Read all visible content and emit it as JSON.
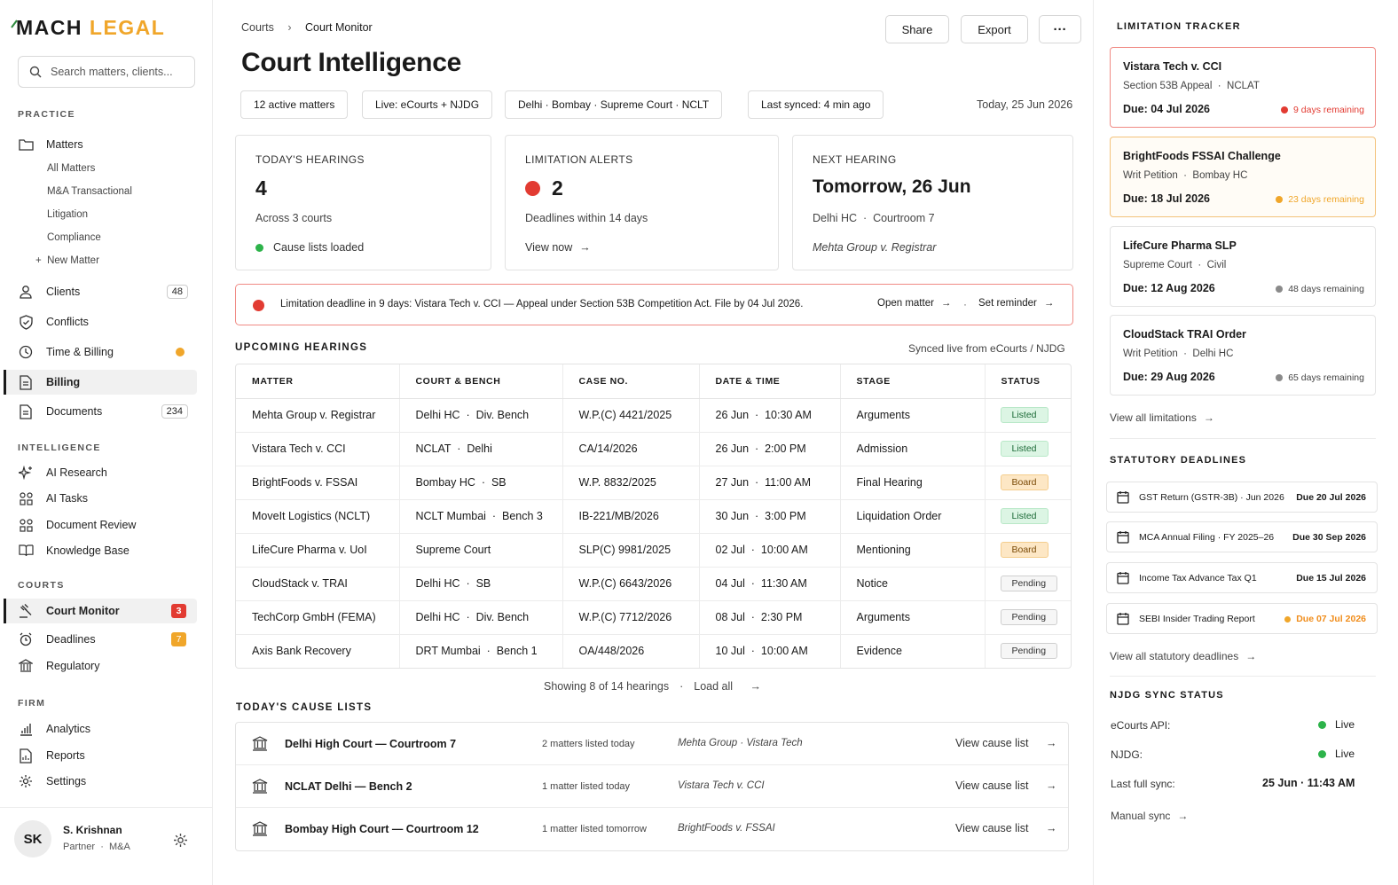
{
  "brand": {
    "part1": "MACH",
    "part2": "LEGAL"
  },
  "search": {
    "placeholder": "Search matters, clients..."
  },
  "sidebar": {
    "practice_heading": "PRACTICE",
    "matters": "Matters",
    "matters_sub": [
      "All Matters",
      "M&A Transactional",
      "Litigation",
      "Compliance",
      "New Matter"
    ],
    "clients": "Clients",
    "clients_count": "48",
    "conflicts": "Conflicts",
    "time_billing": "Time & Billing",
    "billing": "Billing",
    "documents": "Documents",
    "documents_count": "234",
    "intelligence_heading": "INTELLIGENCE",
    "ai_research": "AI Research",
    "ai_tasks": "AI Tasks",
    "document_review": "Document Review",
    "knowledge_base": "Knowledge Base",
    "courts_heading": "COURTS",
    "court_monitor": "Court Monitor",
    "court_monitor_count": "3",
    "deadlines": "Deadlines",
    "deadlines_count": "7",
    "regulatory": "Regulatory",
    "firm_heading": "FIRM",
    "analytics": "Analytics",
    "reports": "Reports",
    "settings": "Settings"
  },
  "user": {
    "initials": "SK",
    "name": "S. Krishnan",
    "role": "Partner",
    "team": "M&A"
  },
  "breadcrumb": {
    "parent": "Courts",
    "current": "Court Monitor"
  },
  "header": {
    "title": "Court Intelligence",
    "share": "Share",
    "export": "Export",
    "more": "···"
  },
  "pills": [
    "12 active matters",
    "Live: eCourts + NJDG",
    "Delhi · Bombay · Supreme Court · NCLT",
    "Last synced: 4 min ago"
  ],
  "today": "Today, 25 Jun 2026",
  "cards": {
    "hearings": {
      "label": "TODAY'S HEARINGS",
      "value": "4",
      "sub": "Across 3 courts",
      "status": "Cause lists loaded"
    },
    "limitation": {
      "label": "LIMITATION ALERTS",
      "value": "2",
      "sub": "Deadlines within 14 days",
      "link": "View now"
    },
    "next": {
      "label": "NEXT HEARING",
      "value": "Tomorrow, 26 Jun",
      "court": "Delhi HC",
      "room": "Courtroom 7",
      "matter": "Mehta Group v. Registrar"
    }
  },
  "alert": {
    "text": "Limitation deadline in 9 days: Vistara Tech v. CCI — Appeal under Section 53B Competition Act. File by 04 Jul 2026.",
    "open": "Open matter",
    "reminder": "Set reminder"
  },
  "upcoming": {
    "heading": "UPCOMING HEARINGS",
    "source": "Synced live from eCourts / NJDG",
    "columns": [
      "MATTER",
      "COURT & BENCH",
      "CASE NO.",
      "DATE & TIME",
      "STAGE",
      "STATUS"
    ],
    "rows": [
      {
        "matter": "Mehta Group v. Registrar",
        "court": "Delhi HC",
        "bench": "Div. Bench",
        "case": "W.P.(C) 4421/2025",
        "date": "26 Jun",
        "time": "10:30 AM",
        "stage": "Arguments",
        "status": "Listed"
      },
      {
        "matter": "Vistara Tech v. CCI",
        "court": "NCLAT",
        "bench": "Delhi",
        "case": "CA/14/2026",
        "date": "26 Jun",
        "time": "2:00 PM",
        "stage": "Admission",
        "status": "Listed"
      },
      {
        "matter": "BrightFoods v. FSSAI",
        "court": "Bombay HC",
        "bench": "SB",
        "case": "W.P. 8832/2025",
        "date": "27 Jun",
        "time": "11:00 AM",
        "stage": "Final Hearing",
        "status": "Board"
      },
      {
        "matter": "MoveIt Logistics (NCLT)",
        "court": "NCLT Mumbai",
        "bench": "Bench 3",
        "case": "IB-221/MB/2026",
        "date": "30 Jun",
        "time": "3:00 PM",
        "stage": "Liquidation Order",
        "status": "Listed"
      },
      {
        "matter": "LifeCure Pharma v. UoI",
        "court": "Supreme Court",
        "bench": "",
        "case": "SLP(C) 9981/2025",
        "date": "02 Jul",
        "time": "10:00 AM",
        "stage": "Mentioning",
        "status": "Board"
      },
      {
        "matter": "CloudStack v. TRAI",
        "court": "Delhi HC",
        "bench": "SB",
        "case": "W.P.(C) 6643/2026",
        "date": "04 Jul",
        "time": "11:30 AM",
        "stage": "Notice",
        "status": "Pending"
      },
      {
        "matter": "TechCorp GmbH (FEMA)",
        "court": "Delhi HC",
        "bench": "Div. Bench",
        "case": "W.P.(C) 7712/2026",
        "date": "08 Jul",
        "time": "2:30 PM",
        "stage": "Arguments",
        "status": "Pending"
      },
      {
        "matter": "Axis Bank Recovery",
        "court": "DRT Mumbai",
        "bench": "Bench 1",
        "case": "OA/448/2026",
        "date": "10 Jul",
        "time": "10:00 AM",
        "stage": "Evidence",
        "status": "Pending"
      }
    ],
    "showing": "Showing 8 of 14 hearings",
    "load_all": "Load all"
  },
  "cause_lists": {
    "heading": "TODAY'S CAUSE LISTS",
    "rows": [
      {
        "court": "Delhi High Court — Courtroom 7",
        "count": "2 matters listed today",
        "matters": "Mehta Group · Vistara Tech",
        "link": "View cause list"
      },
      {
        "court": "NCLAT Delhi — Bench 2",
        "count": "1 matter listed today",
        "matters": "Vistara Tech v. CCI",
        "link": "View cause list"
      },
      {
        "court": "Bombay High Court — Courtroom 12",
        "count": "1 matter listed tomorrow",
        "matters": "BrightFoods v. FSSAI",
        "link": "View cause list"
      }
    ]
  },
  "limitation_tracker": {
    "heading": "LIMITATION TRACKER",
    "items": [
      {
        "title": "Vistara Tech v. CCI",
        "meta1": "Section 53B Appeal",
        "meta2": "NCLAT",
        "due": "Due: 04 Jul 2026",
        "remaining": "9 days remaining",
        "color": "#e23b32"
      },
      {
        "title": "BrightFoods FSSAI Challenge",
        "meta1": "Writ Petition",
        "meta2": "Bombay HC",
        "due": "Due: 18 Jul 2026",
        "remaining": "23 days remaining",
        "color": "#f0a62a"
      },
      {
        "title": "LifeCure Pharma SLP",
        "meta1": "Supreme Court",
        "meta2": "Civil",
        "due": "Due: 12 Aug 2026",
        "remaining": "48 days remaining",
        "color": "#8a8a8a"
      },
      {
        "title": "CloudStack TRAI Order",
        "meta1": "Writ Petition",
        "meta2": "Delhi HC",
        "due": "Due: 29 Aug 2026",
        "remaining": "65 days remaining",
        "color": "#8a8a8a"
      }
    ],
    "view_all": "View all limitations"
  },
  "statutory": {
    "heading": "STATUTORY DEADLINES",
    "items": [
      {
        "name": "GST Return (GSTR-3B) · Jun 2026",
        "due": "Due 20 Jul 2026",
        "warn": false
      },
      {
        "name": "MCA Annual Filing · FY 2025–26",
        "due": "Due 30 Sep 2026",
        "warn": false
      },
      {
        "name": "Income Tax Advance Tax Q1",
        "due": "Due 15 Jul 2026",
        "warn": false
      },
      {
        "name": "SEBI Insider Trading Report",
        "due": "Due 07 Jul 2026",
        "warn": true
      }
    ],
    "view_all": "View all statutory deadlines"
  },
  "njdg": {
    "heading": "NJDG SYNC STATUS",
    "ecourts_label": "eCourts API:",
    "ecourts_status": "Live",
    "njdg_label": "NJDG:",
    "njdg_status": "Live",
    "last_label": "Last full sync:",
    "last_value": "25 Jun · 11:43 AM",
    "manual": "Manual sync"
  },
  "colors": {
    "accent": "#f0a62a",
    "danger": "#e23b32",
    "success": "#2db34a"
  }
}
